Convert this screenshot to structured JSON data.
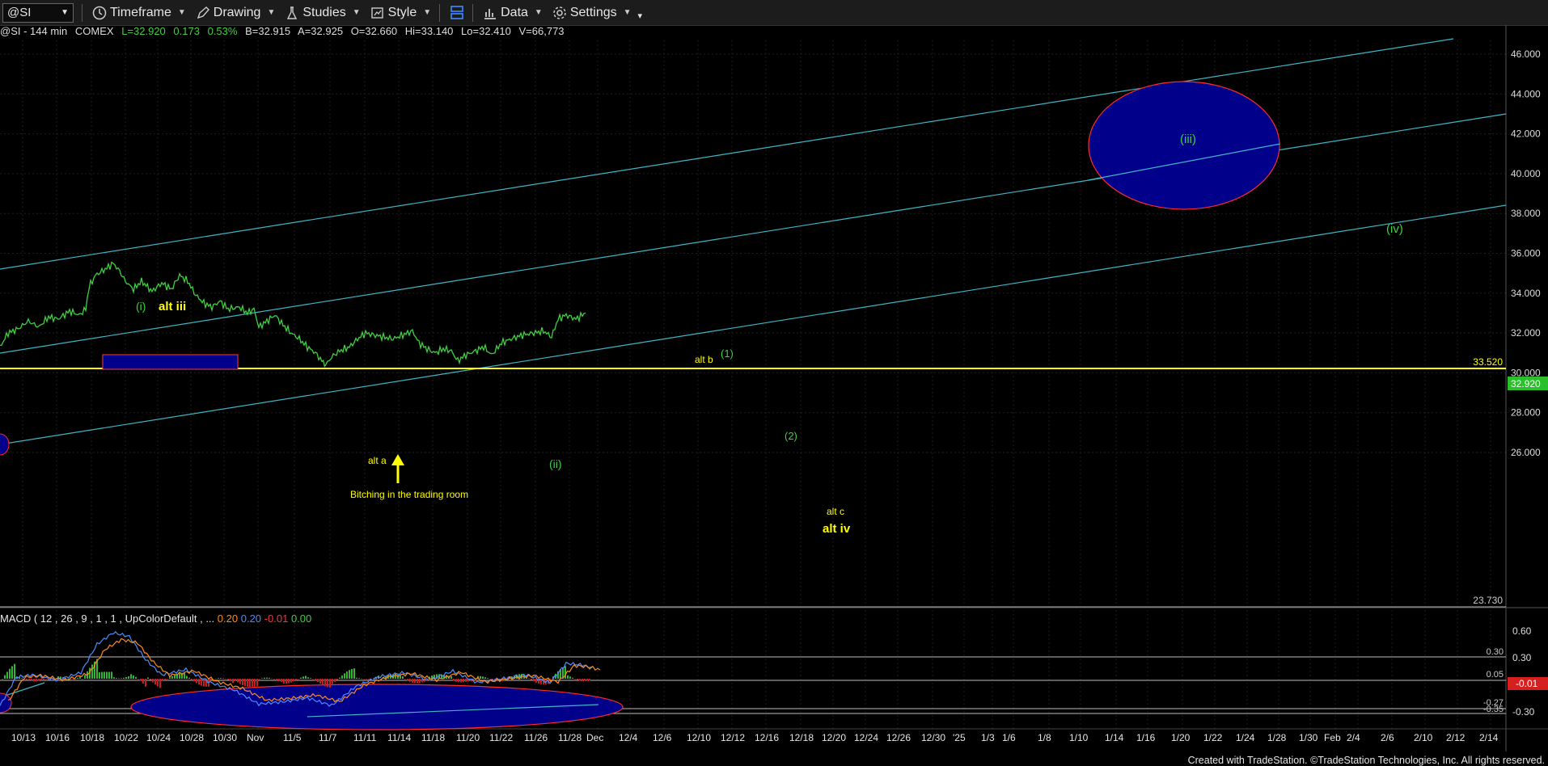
{
  "toolbar": {
    "symbol": "@SI",
    "timeframe": "Timeframe",
    "drawing": "Drawing",
    "studies": "Studies",
    "style": "Style",
    "data": "Data",
    "settings": "Settings"
  },
  "info_bar": {
    "symbol_desc": "@SI - 144 min",
    "exchange": "COMEX",
    "last": "L=32.920",
    "change": "0.173",
    "change_pct": "0.53%",
    "bid": "B=32.915",
    "ask": "A=32.925",
    "open": "O=32.660",
    "high": "Hi=33.140",
    "low": "Lo=32.410",
    "volume": "V=66,773"
  },
  "price_axis": {
    "ticks": [
      "46.000",
      "44.000",
      "42.000",
      "40.000",
      "38.000",
      "36.000",
      "34.000",
      "32.000",
      "30.000",
      "28.000",
      "26.000"
    ],
    "current_price": "32.920",
    "hline_high": "33.520",
    "hline_low": "23.730",
    "colors": {
      "current_price_bg": "#2bbf2b",
      "hline_high": "#ffff00"
    }
  },
  "macd": {
    "label": "MACD ( 12 , 26 , 9 , 1 , 1 , UpColorDefault , ...",
    "v1": "0.20",
    "v2": "0.20",
    "v3": "-0.01",
    "v4": "0.00",
    "axis_ticks": [
      "0.60",
      "0.30",
      "-0.30"
    ],
    "hline_labels": [
      "0.30",
      "0.05",
      "-0.27",
      "-0.35"
    ],
    "current": "-0.01"
  },
  "x_axis": {
    "ticks": [
      "10/13",
      "10/16",
      "10/18",
      "10/22",
      "10/24",
      "10/28",
      "10/30",
      "Nov",
      "11/5",
      "11/7",
      "11/11",
      "11/14",
      "11/18",
      "11/20",
      "11/22",
      "11/26",
      "11/28",
      "Dec",
      "12/4",
      "12/6",
      "12/10",
      "12/12",
      "12/16",
      "12/18",
      "12/20",
      "12/24",
      "12/26",
      "12/30",
      "'25",
      "1/3",
      "1/6",
      "1/8",
      "1/10",
      "1/14",
      "1/16",
      "1/20",
      "1/22",
      "1/24",
      "1/28",
      "1/30",
      "Feb",
      "2/4",
      "2/6",
      "2/10",
      "2/12",
      "2/14"
    ]
  },
  "annotations": {
    "wave_i": "(i)",
    "alt_iii": "alt iii",
    "alt_b": "alt b",
    "wave_1": "(1)",
    "wave_2": "(2)",
    "alt_a": "alt a",
    "bitching": "Bitching in the trading room",
    "wave_ii": "(ii)",
    "alt_c": "alt c",
    "alt_iv": "alt iv",
    "wave_iii": "(iii)",
    "wave_iv": "(iv)"
  },
  "footer": "Created with TradeStation. ©TradeStation Technologies, Inc. All rights reserved.",
  "chart_data": {
    "type": "line",
    "xlabel": "",
    "ylabel": "",
    "ylim": [
      24.5,
      47.2
    ],
    "grid": true,
    "series": [
      {
        "values": [
          [
            0,
            31.3
          ],
          [
            10,
            32.0
          ],
          [
            22,
            32.2
          ],
          [
            35,
            32.6
          ],
          [
            48,
            32.3
          ],
          [
            60,
            32.8
          ],
          [
            72,
            32.7
          ],
          [
            86,
            33.1
          ],
          [
            98,
            32.9
          ],
          [
            106,
            33.2
          ],
          [
            110,
            34.3
          ],
          [
            118,
            34.9
          ],
          [
            130,
            35.2
          ],
          [
            140,
            35.5
          ],
          [
            148,
            35.1
          ],
          [
            155,
            34.6
          ],
          [
            165,
            34.2
          ],
          [
            175,
            34.6
          ],
          [
            188,
            34.1
          ],
          [
            200,
            34.5
          ],
          [
            212,
            34.2
          ],
          [
            222,
            34.9
          ],
          [
            232,
            34.6
          ],
          [
            242,
            33.9
          ],
          [
            252,
            33.5
          ],
          [
            262,
            33.3
          ],
          [
            272,
            33.6
          ],
          [
            282,
            33.2
          ],
          [
            296,
            33.3
          ],
          [
            306,
            33.0
          ],
          [
            314,
            33.2
          ],
          [
            320,
            32.3
          ],
          [
            330,
            32.6
          ],
          [
            340,
            32.9
          ],
          [
            350,
            32.4
          ],
          [
            360,
            32.0
          ],
          [
            370,
            31.7
          ],
          [
            380,
            31.3
          ],
          [
            390,
            31.0
          ],
          [
            398,
            30.6
          ],
          [
            403,
            30.4
          ],
          [
            410,
            30.8
          ],
          [
            420,
            31.1
          ],
          [
            432,
            31.3
          ],
          [
            442,
            31.7
          ],
          [
            452,
            32.0
          ],
          [
            462,
            31.9
          ],
          [
            474,
            31.8
          ],
          [
            486,
            31.7
          ],
          [
            498,
            31.9
          ],
          [
            510,
            32.1
          ],
          [
            518,
            31.5
          ],
          [
            528,
            31.2
          ],
          [
            538,
            31.0
          ],
          [
            548,
            31.2
          ],
          [
            558,
            31.1
          ],
          [
            566,
            30.6
          ],
          [
            576,
            30.9
          ],
          [
            588,
            31.1
          ],
          [
            598,
            31.3
          ],
          [
            608,
            30.9
          ],
          [
            620,
            31.5
          ],
          [
            632,
            31.7
          ],
          [
            646,
            31.9
          ],
          [
            660,
            32.0
          ],
          [
            672,
            32.1
          ],
          [
            682,
            31.8
          ],
          [
            690,
            32.7
          ],
          [
            700,
            32.9
          ],
          [
            712,
            32.7
          ],
          [
            724,
            33.0
          ]
        ]
      }
    ]
  }
}
